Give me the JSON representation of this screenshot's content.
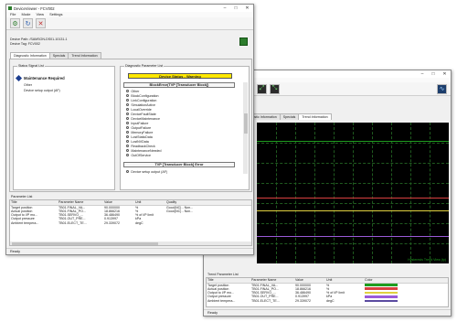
{
  "back": {
    "menu": [
      "File",
      "Mode",
      "View",
      "Settings"
    ],
    "device_info_line": "SAMSON Flow...",
    "tabs": [
      "Diagnostic Information",
      "Specials",
      "Trend Information"
    ],
    "active_tab": "Trend Information",
    "trend_label": "Hysteresis Trend View (ty)",
    "trend_colors": {
      "green": "#1f9c1f",
      "red": "#d94040",
      "yellow": "#e0d040",
      "purple": "#9a5ad8"
    },
    "trend_param_title": "Trend Parameter List",
    "columns": [
      "Title",
      "Parameter Name",
      "Value",
      "Unit",
      "Color"
    ],
    "rows": [
      {
        "title": "Target position",
        "param": "TB01.FINAL_VA...",
        "value": "90.000000",
        "unit": "%",
        "color": "#1f9c1f"
      },
      {
        "title": "Actual position",
        "param": "TB01.FINAL_PO...",
        "value": "18.866216",
        "unit": "%",
        "color": "#d94040"
      },
      {
        "title": "Output to I/P mo...",
        "param": "TB01.SERVO_...",
        "value": "36.486490",
        "unit": "% of I/P limit",
        "color": "#e0d040"
      },
      {
        "title": "Output pressure",
        "param": "TB01.OUT_PRE...",
        "value": "0.913997",
        "unit": "kPa",
        "color": "#9a5ad8"
      },
      {
        "title": "Ambient tempera...",
        "param": "TB01.ELECT_TE...",
        "value": "29.339072",
        "unit": "degC",
        "color": "#5a4aa0"
      }
    ],
    "status": "Ready"
  },
  "front": {
    "title": "DeviceViewer - FCV002",
    "menu": [
      "File",
      "Mode",
      "View",
      "Settings"
    ],
    "device_path": "Device Path: /SAMSON-DS01-10131-1",
    "device_tag": "Device Tag: FCV002",
    "tabs": [
      "Diagnostic Information",
      "Specials",
      "Trend Information"
    ],
    "active_tab": "Diagnostic Information",
    "status_signal": {
      "title": "Status Signal List",
      "heading": "Maintenance Required",
      "items": [
        "Other",
        "Device setup output (AF)"
      ]
    },
    "diag_list": {
      "title": "Diagnostic Parameter List",
      "device_status": "Device Status - Warning",
      "block_header": "BlockError(TVP [Transducer Block])",
      "items": [
        "Other",
        "BlockConfiguration",
        "LinkConfiguration",
        "SimulationActive",
        "LocalOverride",
        "DeviceFaultState",
        "DeviceMaintenance",
        "InputFailure",
        "OutputFailure",
        "MemoryFailure",
        "LostStaticData",
        "LostNVData",
        "ReadbackCheck",
        "MaintenanceNeeded",
        "OutOfService"
      ],
      "block_header2": "TVP [Transducer Block] Error",
      "items2": [
        "Device setup output (AF)"
      ]
    },
    "param_list": {
      "title": "Parameter List",
      "columns": [
        "Title",
        "Parameter Name",
        "Value",
        "Unit",
        "Quality"
      ],
      "rows": [
        {
          "title": "Target position",
          "param": "TB01.FINAL_VA...",
          "value": "90.000000",
          "unit": "%",
          "quality": "Good(NC) - Non..."
        },
        {
          "title": "Actual position",
          "param": "TB01.FINAL_PO...",
          "value": "18.866216",
          "unit": "%",
          "quality": "Good(NC) - Non..."
        },
        {
          "title": "Output to I/P mo...",
          "param": "TB01.SERVO_...",
          "value": "36.486490",
          "unit": "% of I/P limit",
          "quality": ""
        },
        {
          "title": "Output pressure",
          "param": "TB01.OUT_PRE...",
          "value": "0.913997",
          "unit": "kPa",
          "quality": ""
        },
        {
          "title": "Ambient tempera...",
          "param": "TB01.ELECT_TE...",
          "value": "29.339072",
          "unit": "degC",
          "quality": ""
        }
      ]
    },
    "status": "Ready"
  }
}
